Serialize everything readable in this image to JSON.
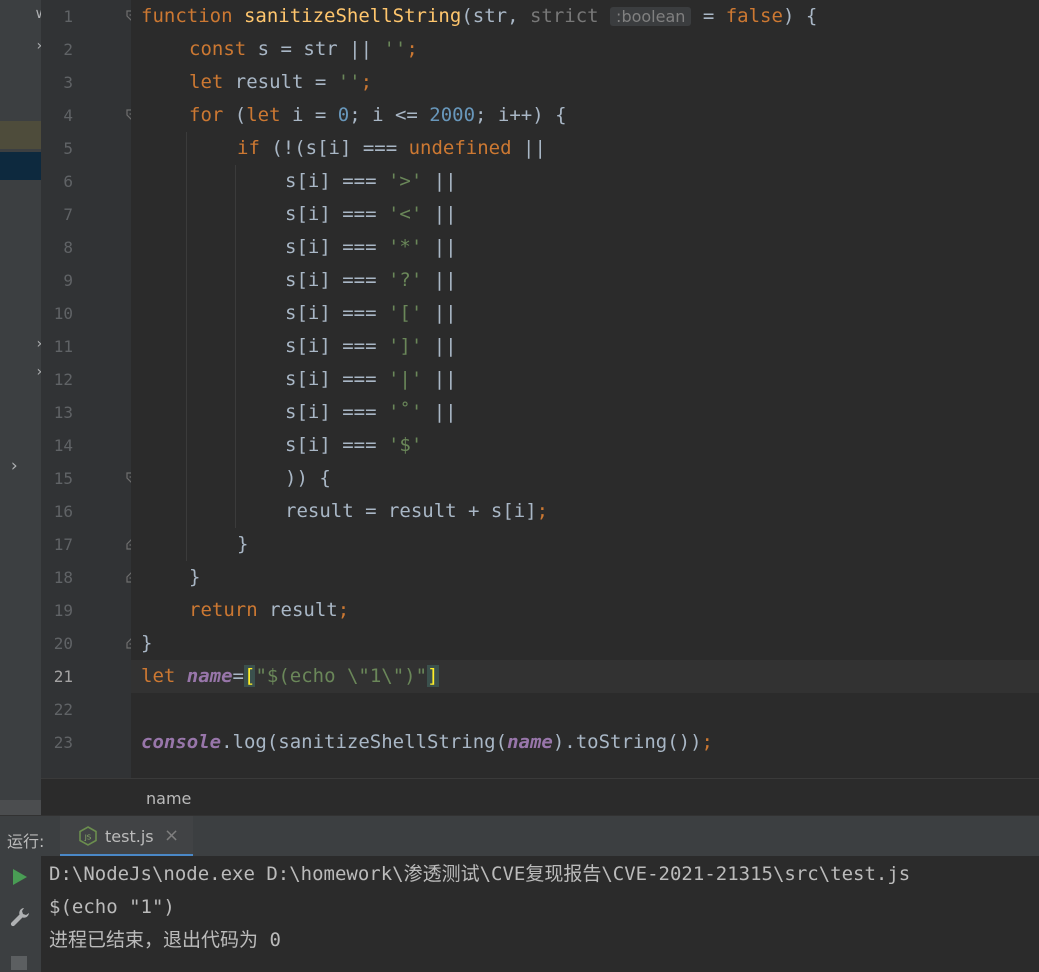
{
  "editor": {
    "line_numbers": [
      "1",
      "2",
      "3",
      "4",
      "5",
      "6",
      "7",
      "8",
      "9",
      "10",
      "11",
      "12",
      "13",
      "14",
      "15",
      "16",
      "17",
      "18",
      "19",
      "20",
      "21",
      "22",
      "23"
    ],
    "param_hint": ":boolean",
    "line1": {
      "kw": "function",
      "fn": "sanitizeShellString",
      "p1": "(str, ",
      "p2": "strict",
      "p3": " = ",
      "val": "false",
      "p4": ") {"
    },
    "line2": {
      "kw": "const",
      "mid": " s = str || ",
      "str": "''",
      "end": ";"
    },
    "line3": {
      "kw": "let",
      "mid": " result = ",
      "str": "''",
      "end": ";"
    },
    "line4": {
      "kw": "for",
      "a": " (",
      "kw2": "let",
      "b": " i = ",
      "n1": "0",
      "c": "; i <= ",
      "n2": "2000",
      "d": "; i++) {"
    },
    "line5": {
      "kw": "if",
      "a": " (!(s[i] === ",
      "kw2": "undefined",
      "b": " ||"
    },
    "compare_lines": [
      {
        "a": "s[i] === ",
        "s": "'>'",
        "b": " ||"
      },
      {
        "a": "s[i] === ",
        "s": "'<'",
        "b": " ||"
      },
      {
        "a": "s[i] === ",
        "s": "'*'",
        "b": " ||"
      },
      {
        "a": "s[i] === ",
        "s": "'?'",
        "b": " ||"
      },
      {
        "a": "s[i] === ",
        "s": "'['",
        "b": " ||"
      },
      {
        "a": "s[i] === ",
        "s": "']'",
        "b": " ||"
      },
      {
        "a": "s[i] === ",
        "s": "'|'",
        "b": " ||"
      },
      {
        "a": "s[i] === ",
        "s": "'˚'",
        "b": " ||"
      },
      {
        "a": "s[i] === ",
        "s": "'$'",
        "b": ""
      }
    ],
    "line15": ")) {",
    "line16": {
      "a": "result = result + s[i]",
      "end": ";"
    },
    "line17": "}",
    "line18": "}",
    "line19": {
      "kw": "return",
      "a": " result",
      "end": ";"
    },
    "line20": "}",
    "line21": {
      "kw": "let",
      "sp": " ",
      "var": "name",
      "eq": "=",
      "lb": "[",
      "str": "\"$(echo \\\"1\\\")\"",
      "rb": "]"
    },
    "line23": {
      "obj": "console",
      "a": ".log(sanitizeShellString(",
      "var": "name",
      "b": ").toString())",
      "end": ";"
    }
  },
  "status": {
    "text": "name"
  },
  "run": {
    "label": "运行:",
    "tab": "test.js",
    "tab_close": "×",
    "output": [
      "D:\\NodeJs\\node.exe D:\\homework\\渗透测试\\CVE复现报告\\CVE-2021-21315\\src\\test.js",
      "$(echo \"1\")",
      "进程已结束，退出代码为 0"
    ]
  },
  "colors": {
    "keyword": "#cc7832",
    "function": "#ffc66d",
    "string": "#6a8759",
    "number": "#6897bb",
    "global_var": "#9876aa",
    "accent": "#4a88c7"
  }
}
